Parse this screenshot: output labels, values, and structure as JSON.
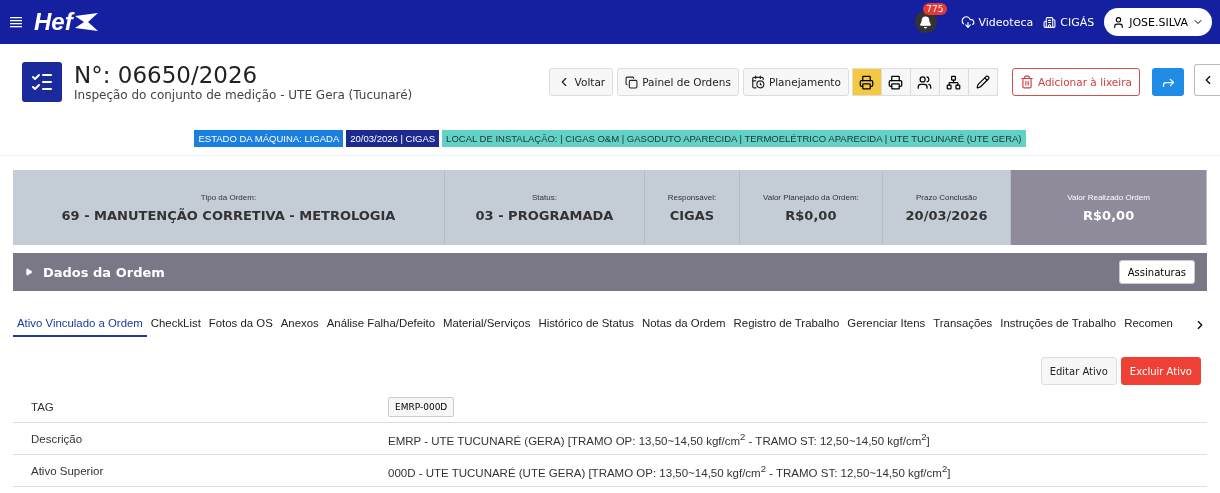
{
  "navbar": {
    "logo": "Hef",
    "notifications": "775",
    "links": [
      {
        "kind": "cloud",
        "label": "Videoteca"
      },
      {
        "kind": "building",
        "label": "CIGÁS"
      }
    ],
    "user": "JOSE.SILVA"
  },
  "header": {
    "title": "N°: 06650/2026",
    "subtitle": "Inspeção do conjunto de medição - UTE Gera (Tucunaré)"
  },
  "toolbar": {
    "buttons": [
      {
        "kind": "back",
        "label": "Voltar"
      },
      {
        "kind": "copy",
        "label": "Painel de Ordens"
      },
      {
        "kind": "calendar",
        "label": "Planejamento"
      }
    ],
    "icon_buttons": [
      {
        "kind": "printer",
        "selected": true
      },
      {
        "kind": "printer",
        "selected": false
      },
      {
        "kind": "users",
        "selected": false
      },
      {
        "kind": "hierarchy",
        "selected": false
      },
      {
        "kind": "pencil",
        "selected": false
      }
    ],
    "trash_button": "Adicionar à lixeira"
  },
  "badges": [
    {
      "label": "ESTADO DA MÁQUINA: LIGADA",
      "color": "#1b7fe0"
    },
    {
      "label": "20/03/2026 | CIGAS",
      "color": "#1c2a8f"
    },
    {
      "label": "LOCAL DE INSTALAÇÃO: | CIGAS O&M | GASODUTO APARECIDA | TERMOELÉTRICO APARECIDA | UTE TUCUNARÉ (UTE GERA)",
      "color": "#62d2c6"
    }
  ],
  "summary": [
    {
      "label": "Tipo da Ordem:",
      "value": "69 - MANUTENÇÃO CORRETIVA - METROLOGIA",
      "highlighted": false
    },
    {
      "label": "Status:",
      "value": "03 - PROGRAMADA",
      "highlighted": false
    },
    {
      "label": "Responsável:",
      "value": "CIGAS",
      "highlighted": false
    },
    {
      "label": "Valor Planejado da Ordem:",
      "value": "R$0,00",
      "highlighted": false
    },
    {
      "label": "Prazo Conclusão",
      "value": "20/03/2026",
      "highlighted": false
    },
    {
      "label": "Valor Realizado Ordem",
      "value": "R$0,00",
      "highlighted": true
    }
  ],
  "section": {
    "title": "Dados da Ordem",
    "expanded": false,
    "button": "Assinaturas"
  },
  "tabs": [
    {
      "label": "Ativo Vinculado a Ordem",
      "selected": true
    },
    {
      "label": "CheckList",
      "selected": false
    },
    {
      "label": "Fotos da OS",
      "selected": false
    },
    {
      "label": "Anexos",
      "selected": false
    },
    {
      "label": "Análise Falha/Defeito",
      "selected": false
    },
    {
      "label": "Material/Serviços",
      "selected": false
    },
    {
      "label": "Histórico de Status",
      "selected": false
    },
    {
      "label": "Notas da Ordem",
      "selected": false
    },
    {
      "label": "Registro de Trabalho",
      "selected": false
    },
    {
      "label": "Gerenciar Itens",
      "selected": false
    },
    {
      "label": "Transações",
      "selected": false
    },
    {
      "label": "Instruções de Trabalho",
      "selected": false
    },
    {
      "label": "Recomen",
      "selected": false
    }
  ],
  "actions": [
    {
      "kind": "default",
      "label": "Editar Ativo"
    },
    {
      "kind": "danger",
      "label": "Excluir Ativo"
    }
  ],
  "rows": [
    {
      "kind": "tag",
      "label": "TAG",
      "value": "EMRP-000D"
    },
    {
      "kind": "text",
      "label": "Descrição",
      "value": "EMRP - UTE TUCUNARÉ (GERA) [TRAMO OP: 13,50~14,50 kgf/cm$^{2}$ - TRAMO ST: 12,50~14,50 kgf/cm$^{2}$]"
    },
    {
      "kind": "text",
      "label": "Ativo Superior",
      "value": "000D - UTE TUCUNARÉ (UTE GERA) [TRAMO OP: 13,50~14,50 kgf/cm$^{2}$ - TRAMO ST: 12,50~14,50 kgf/cm$^{2}$]"
    }
  ]
}
